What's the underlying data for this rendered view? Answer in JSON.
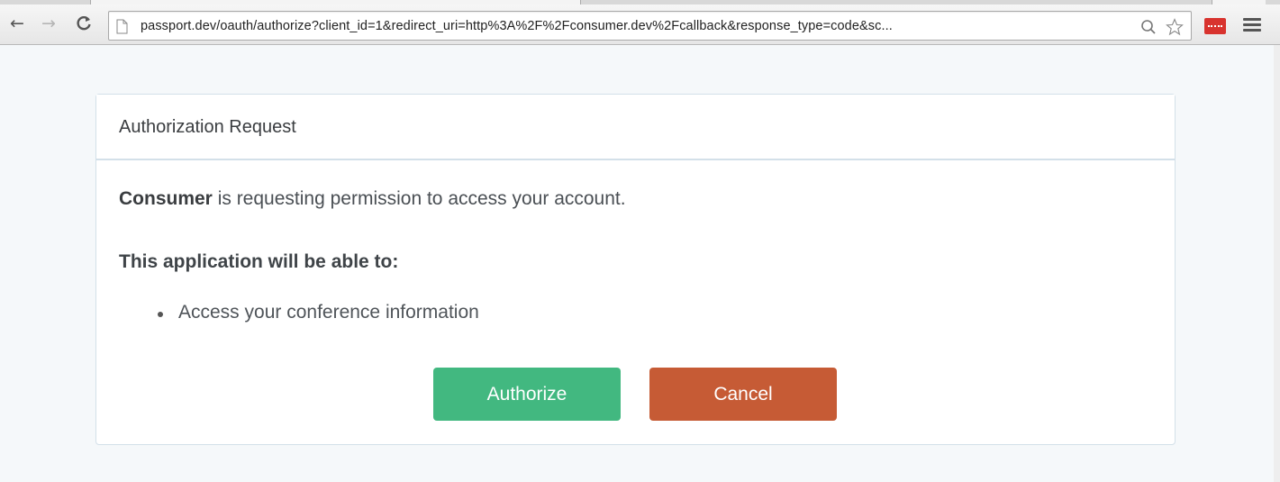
{
  "browser": {
    "url": "passport.dev/oauth/authorize?client_id=1&redirect_uri=http%3A%2F%2Fconsumer.dev%2Fcallback&response_type=code&sc..."
  },
  "card": {
    "title": "Authorization Request",
    "client_name": "Consumer",
    "request_text": " is requesting permission to access your account.",
    "scopes_heading": "This application will be able to:",
    "scopes": [
      "Access your conference information"
    ],
    "authorize_label": "Authorize",
    "cancel_label": "Cancel"
  },
  "colors": {
    "authorize": "#42b880",
    "cancel": "#c65b35",
    "card_border": "#d3e0e9",
    "page_background": "#f5f8fa"
  }
}
